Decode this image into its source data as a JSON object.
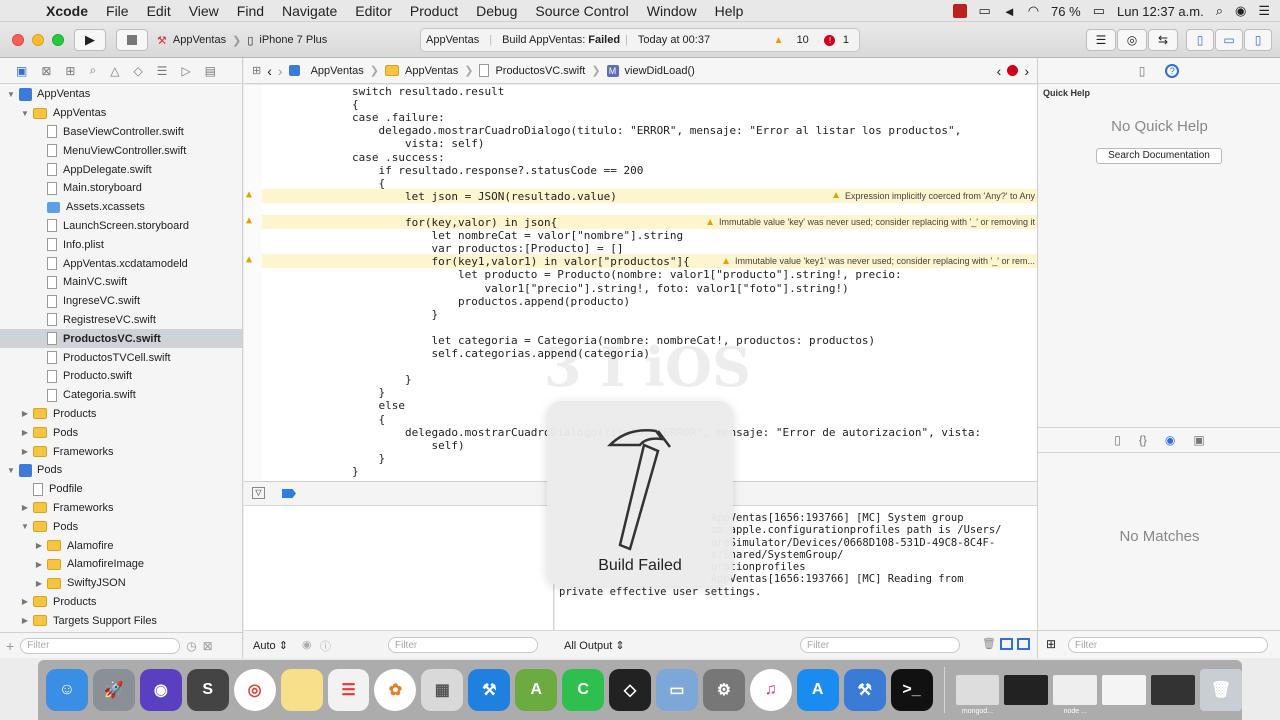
{
  "menubar": {
    "app_name": "Xcode",
    "items": [
      "File",
      "Edit",
      "View",
      "Find",
      "Navigate",
      "Editor",
      "Product",
      "Debug",
      "Source Control",
      "Window",
      "Help"
    ],
    "battery": "76 %",
    "clock": "Lun 12:37 a.m."
  },
  "toolbar": {
    "scheme_name": "AppVentas",
    "device": "iPhone 7 Plus",
    "activity_project": "AppVentas",
    "activity_status_prefix": "Build AppVentas:",
    "activity_status": "Failed",
    "activity_time": "Today at 00:37",
    "warning_count": "10",
    "error_count": "1"
  },
  "navigator": {
    "rows": [
      {
        "label": "AppVentas",
        "type": "project",
        "depth": 0,
        "disclosure": "open"
      },
      {
        "label": "AppVentas",
        "type": "folder",
        "depth": 1,
        "disclosure": "open"
      },
      {
        "label": "BaseViewController.swift",
        "type": "file",
        "depth": 2
      },
      {
        "label": "MenuViewController.swift",
        "type": "file",
        "depth": 2
      },
      {
        "label": "AppDelegate.swift",
        "type": "file",
        "depth": 2
      },
      {
        "label": "Main.storyboard",
        "type": "file",
        "depth": 2
      },
      {
        "label": "Assets.xcassets",
        "type": "assets",
        "depth": 2
      },
      {
        "label": "LaunchScreen.storyboard",
        "type": "file",
        "depth": 2
      },
      {
        "label": "Info.plist",
        "type": "file",
        "depth": 2
      },
      {
        "label": "AppVentas.xcdatamodeld",
        "type": "file",
        "depth": 2
      },
      {
        "label": "MainVC.swift",
        "type": "file",
        "depth": 2
      },
      {
        "label": "IngreseVC.swift",
        "type": "file",
        "depth": 2
      },
      {
        "label": "RegistreseVC.swift",
        "type": "file",
        "depth": 2
      },
      {
        "label": "ProductosVC.swift",
        "type": "file",
        "depth": 2,
        "selected": true
      },
      {
        "label": "ProductosTVCell.swift",
        "type": "file",
        "depth": 2
      },
      {
        "label": "Producto.swift",
        "type": "file",
        "depth": 2
      },
      {
        "label": "Categoria.swift",
        "type": "file",
        "depth": 2
      },
      {
        "label": "Products",
        "type": "folder",
        "depth": 1,
        "disclosure": "closed"
      },
      {
        "label": "Pods",
        "type": "folder",
        "depth": 1,
        "disclosure": "closed"
      },
      {
        "label": "Frameworks",
        "type": "folder",
        "depth": 1,
        "disclosure": "closed"
      },
      {
        "label": "Pods",
        "type": "project",
        "depth": 0,
        "disclosure": "open"
      },
      {
        "label": "Podfile",
        "type": "file",
        "depth": 1
      },
      {
        "label": "Frameworks",
        "type": "folder",
        "depth": 1,
        "disclosure": "closed"
      },
      {
        "label": "Pods",
        "type": "folder",
        "depth": 1,
        "disclosure": "open"
      },
      {
        "label": "Alamofire",
        "type": "folder",
        "depth": 2,
        "disclosure": "closed"
      },
      {
        "label": "AlamofireImage",
        "type": "folder",
        "depth": 2,
        "disclosure": "closed"
      },
      {
        "label": "SwiftyJSON",
        "type": "folder",
        "depth": 2,
        "disclosure": "closed"
      },
      {
        "label": "Products",
        "type": "folder",
        "depth": 1,
        "disclosure": "closed"
      },
      {
        "label": "Targets Support Files",
        "type": "folder",
        "depth": 1,
        "disclosure": "closed"
      }
    ],
    "filter_placeholder": "Filter"
  },
  "jumpbar": {
    "crumbs": [
      "AppVentas",
      "AppVentas",
      "ProductosVC.swift",
      "viewDidLoad()"
    ],
    "method_badge": "M"
  },
  "code": {
    "lines": [
      "switch resultado.result",
      "{",
      "case .failure:",
      "    delegado.mostrarCuadroDialogo(titulo: \"ERROR\", mensaje: \"Error al listar los productos\",",
      "        vista: self)",
      "case .success:",
      "    if resultado.response?.statusCode == 200",
      "    {",
      "        let json = JSON(resultado.value)",
      "",
      "        for(key,valor) in json{",
      "            let nombreCat = valor[\"nombre\"].string",
      "            var productos:[Producto] = []",
      "            for(key1,valor1) in valor[\"productos\"]{",
      "                let producto = Producto(nombre: valor1[\"producto\"].string!, precio:",
      "                    valor1[\"precio\"].string!, foto: valor1[\"foto\"].string!)",
      "                productos.append(producto)",
      "            }",
      "",
      "            let categoria = Categoria(nombre: nombreCat!, productos: productos)",
      "            self.categorias.append(categoria)",
      "",
      "        }",
      "    }",
      "    else",
      "    {",
      "        delegado.mostrarCuadroDialogo(titulo: \"ERROR\", mensaje: \"Error de autorizacion\", vista:",
      "            self)",
      "    }",
      "}"
    ],
    "warnings": [
      {
        "line": 8,
        "text": "Expression implicitly coerced from 'Any?' to Any"
      },
      {
        "line": 10,
        "text": "Immutable value 'key' was never used; consider replacing with '_' or removing it"
      },
      {
        "line": 13,
        "text": "Immutable value 'key1' was never used; consider replacing with '_' or rem..."
      }
    ],
    "watermark": "3 I iOS"
  },
  "hud": {
    "label": "Build Failed"
  },
  "console": {
    "lines": [
      "                        AppVentas[1656:193766] [MC] System group",
      "                        om.apple.configurationprofiles path is /Users/",
      "                        oreSimulator/Devices/0668D108-531D-49C8-8C4F-",
      "                        s/Shared/SystemGroup/",
      "                        urationprofiles",
      "                        AppVentas[1656:193766] [MC] Reading from",
      "private effective user settings."
    ]
  },
  "debug_footer": {
    "auto_label": "Auto",
    "output_label": "All Output",
    "filter_placeholder": "Filter"
  },
  "utilities": {
    "quick_help_title": "Quick Help",
    "no_quick_help": "No Quick Help",
    "search_docs": "Search Documentation",
    "no_matches": "No Matches",
    "filter_placeholder": "Filter"
  },
  "dock": {
    "label_mongod": "mongod...",
    "label_node": "node ..."
  },
  "colors": {
    "warning_highlight": "#fdf5cd",
    "selection": "#cfd3d8",
    "error_red": "#d0021b",
    "warning_yellow": "#e1a100"
  }
}
